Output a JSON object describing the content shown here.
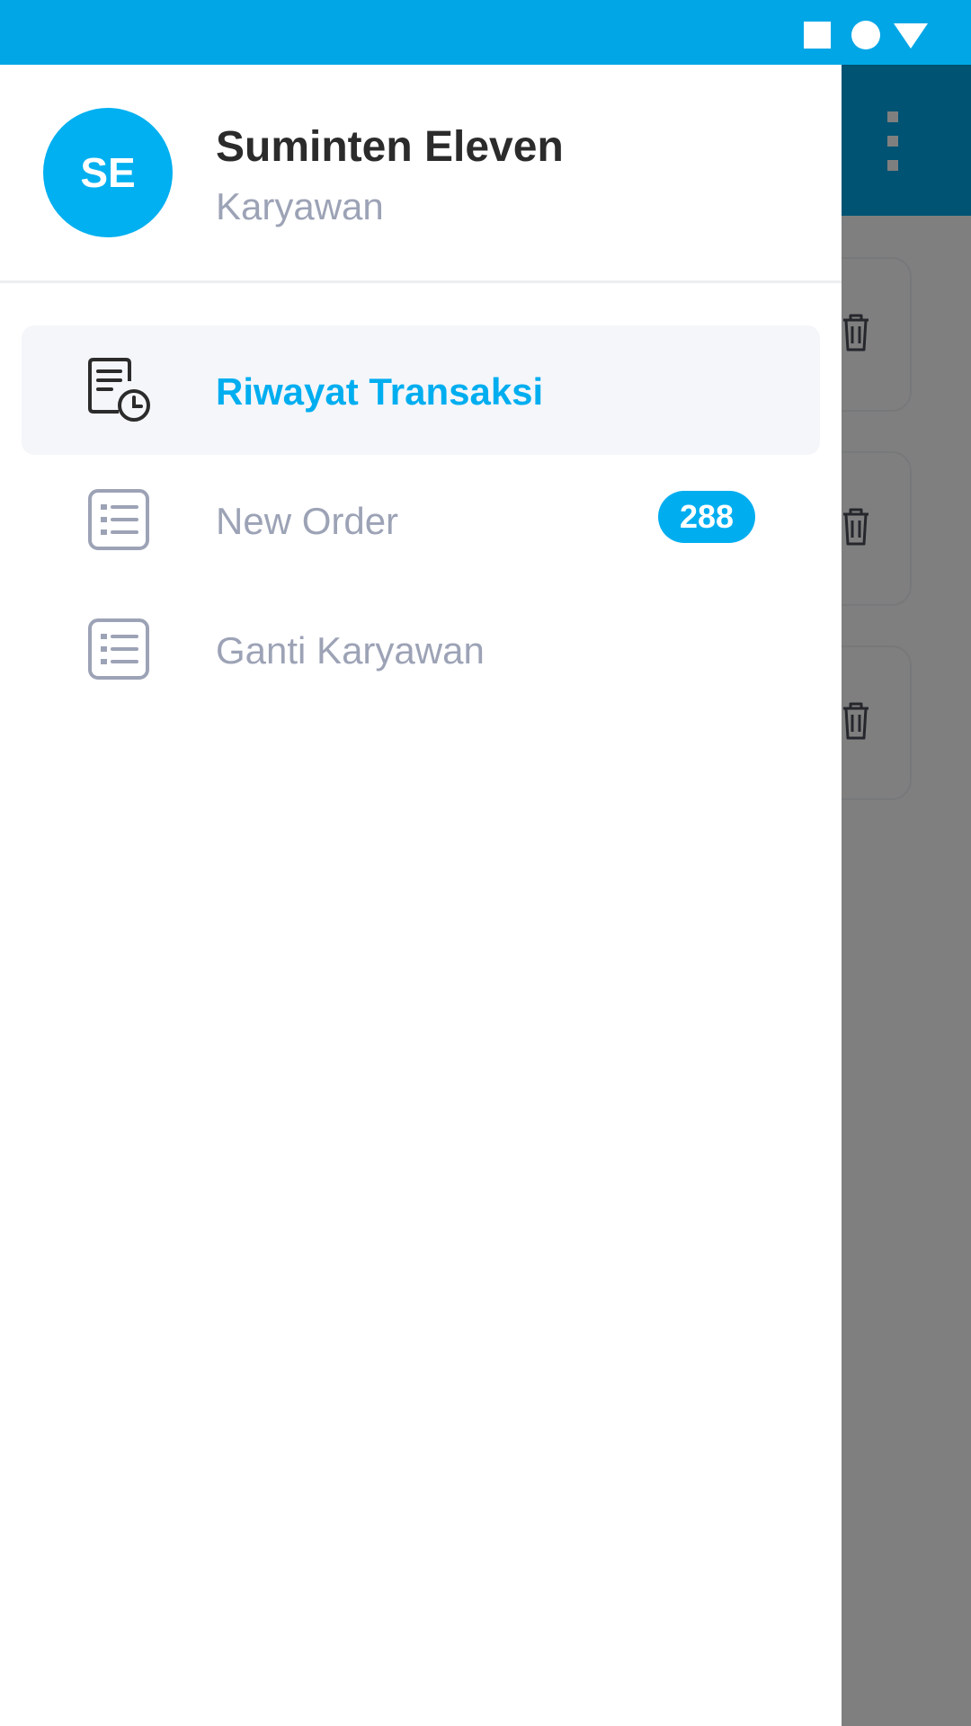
{
  "colors": {
    "status_bar": "#00a6e6",
    "accent": "#00aef0",
    "text_dark": "#2b2b2b",
    "text_muted": "#9da3b6",
    "active_bg": "#f5f6fa",
    "scrim": "rgba(0,0,0,0.5)"
  },
  "status_bar": {
    "icons": [
      "square-icon",
      "circle-icon",
      "triangle-icon"
    ]
  },
  "profile": {
    "initials": "SE",
    "name": "Suminten Eleven",
    "role": "Karyawan"
  },
  "menu": {
    "items": [
      {
        "label": "Riwayat Transaksi",
        "icon": "document-clock-icon",
        "active": true
      },
      {
        "label": "New Order",
        "icon": "list-icon",
        "badge": "288",
        "active": false
      },
      {
        "label": "Ganti Karyawan",
        "icon": "list-icon",
        "active": false
      }
    ]
  },
  "background": {
    "toolbar_icon": "more-vertical-icon",
    "cards": [
      {
        "icon": "trash-icon"
      },
      {
        "icon": "trash-icon"
      },
      {
        "icon": "trash-icon"
      }
    ]
  }
}
